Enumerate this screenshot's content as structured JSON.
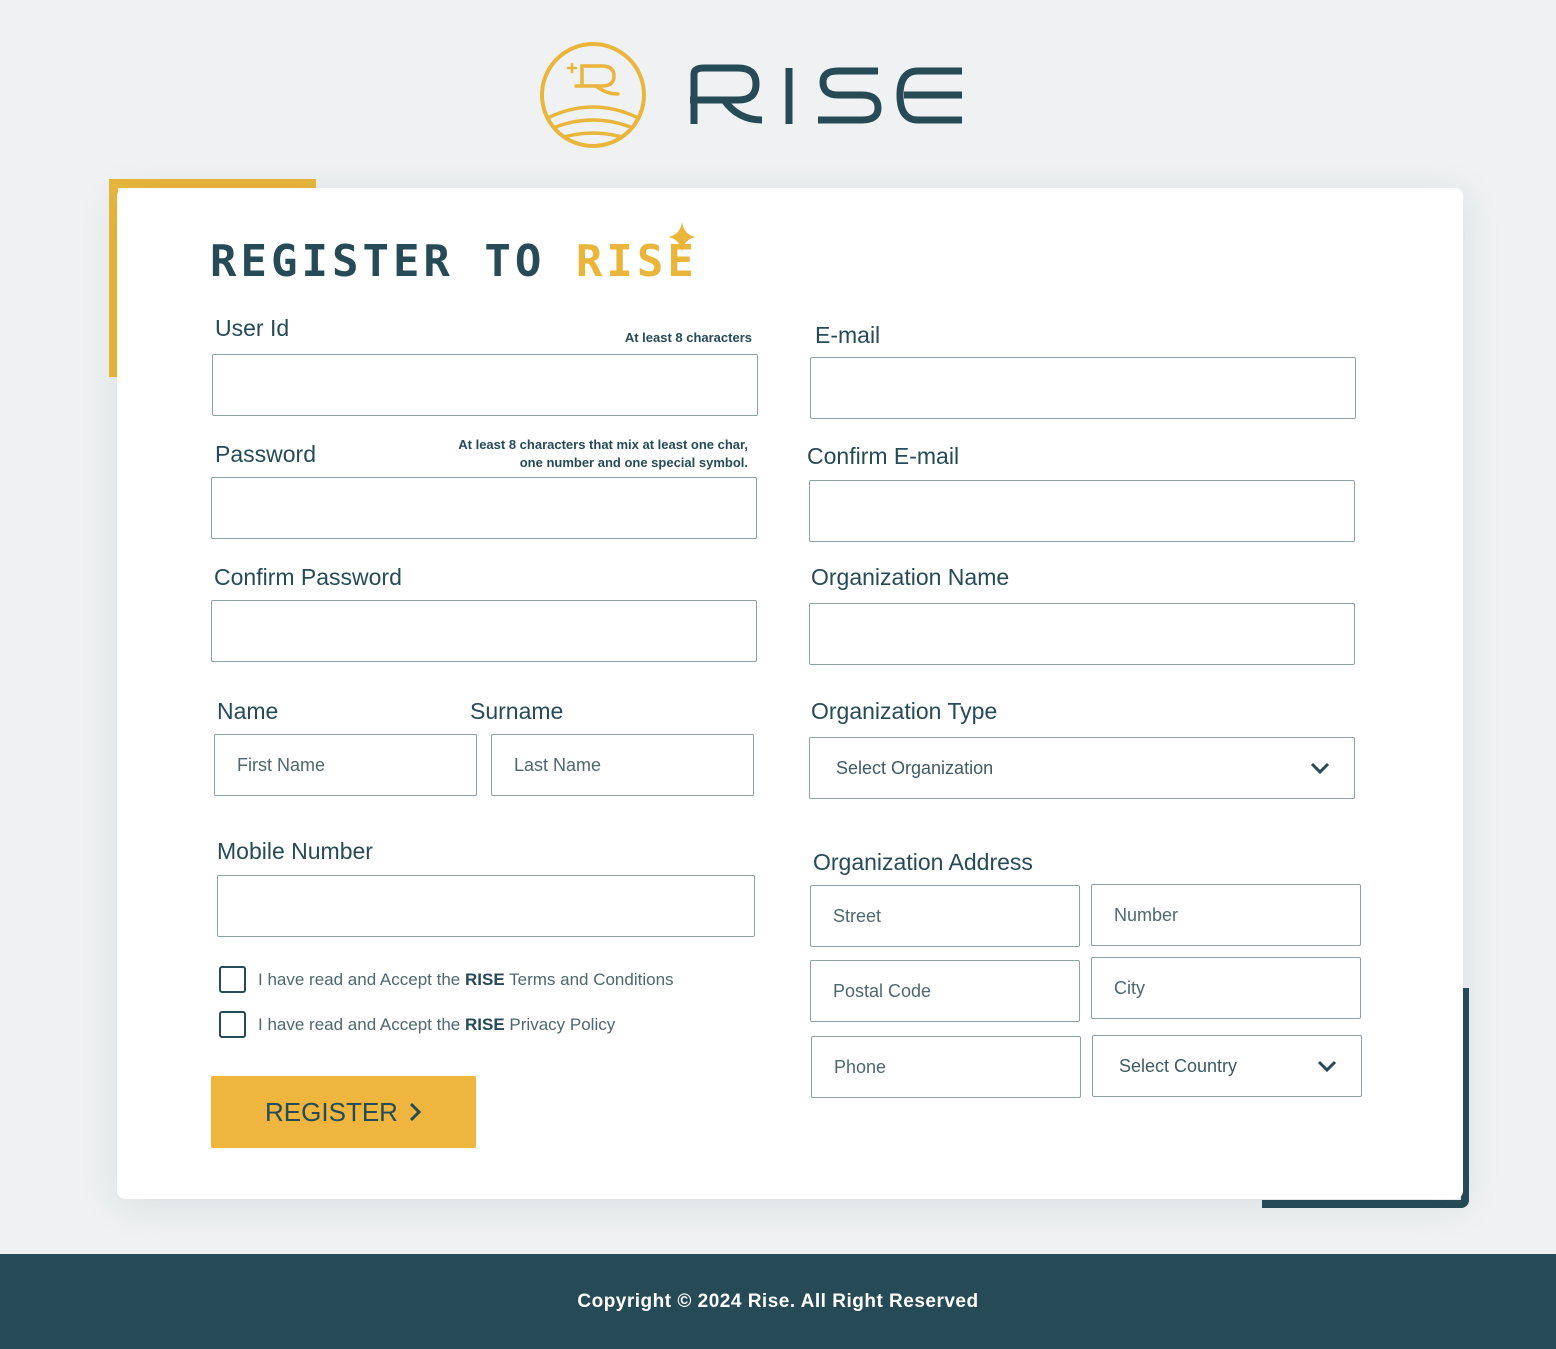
{
  "brand": {
    "name": "RISE",
    "primary_color": "#264b57",
    "accent_color": "#e9b63b"
  },
  "title": {
    "prefix": "REGISTER TO",
    "highlight": "RISE"
  },
  "left": {
    "user_id": {
      "label": "User Id",
      "hint": "At least 8 characters",
      "value": ""
    },
    "password": {
      "label": "Password",
      "hint_line1": "At least 8 characters that mix at least one char,",
      "hint_line2": "one number and one special symbol.",
      "value": ""
    },
    "confirm_password": {
      "label": "Confirm Password",
      "value": ""
    },
    "name": {
      "label": "Name",
      "placeholder": "First Name"
    },
    "surname": {
      "label": "Surname",
      "placeholder": "Last Name"
    },
    "mobile": {
      "label": "Mobile Number",
      "value": ""
    },
    "terms": {
      "prefix": "I have read and Accept the",
      "brand": "RISE",
      "suffix": "Terms and Conditions",
      "checked": false
    },
    "privacy": {
      "prefix": "I have read and Accept the",
      "brand": "RISE",
      "suffix": "Privacy Policy",
      "checked": false
    },
    "register_label": "REGISTER"
  },
  "right": {
    "email": {
      "label": "E-mail",
      "value": ""
    },
    "confirm_email": {
      "label": "Confirm E-mail",
      "value": ""
    },
    "org_name": {
      "label": "Organization Name",
      "value": ""
    },
    "org_type": {
      "label": "Organization Type",
      "selected": "Select Organization"
    },
    "address": {
      "label": "Organization Address",
      "street_placeholder": "Street",
      "number_placeholder": "Number",
      "postal_placeholder": "Postal Code",
      "city_placeholder": "City",
      "phone_placeholder": "Phone",
      "country_selected": "Select Country"
    }
  },
  "footer": {
    "copyright": "Copyright © 2024 Rise. All Right Reserved"
  }
}
